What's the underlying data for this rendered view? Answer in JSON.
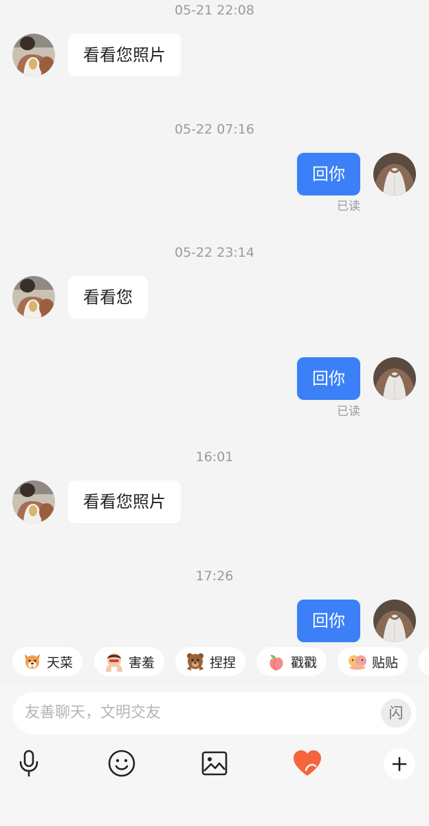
{
  "messages": [
    {
      "time": "05-21 22:08",
      "text": "看看您照片"
    },
    {
      "time": "05-22 07:16",
      "text": "回你",
      "status": "已读"
    },
    {
      "time": "05-22 23:14",
      "text": "看看您"
    },
    {
      "text": "回你",
      "status": "已读"
    },
    {
      "time": "16:01",
      "text": "看看您照片"
    },
    {
      "time": "17:26",
      "text": "回你"
    }
  ],
  "chips": [
    {
      "label": "天菜",
      "icon": "dog-face-icon"
    },
    {
      "label": "害羞",
      "icon": "shy-face-icon"
    },
    {
      "label": "捏捏",
      "icon": "bear-icon"
    },
    {
      "label": "戳戳",
      "icon": "peach-icon"
    },
    {
      "label": "贴贴",
      "icon": "hug-icon"
    }
  ],
  "input": {
    "placeholder": "友善聊天，文明交友",
    "flash_label": "闪"
  },
  "toolbar": [
    "microphone-icon",
    "emoji-icon",
    "image-icon",
    "gift-heart-icon",
    "plus-icon"
  ],
  "colors": {
    "outgoing_bubble": "#3b80f7",
    "incoming_bubble": "#ffffff",
    "background": "#f4f4f4",
    "heart": "#f5643d"
  }
}
